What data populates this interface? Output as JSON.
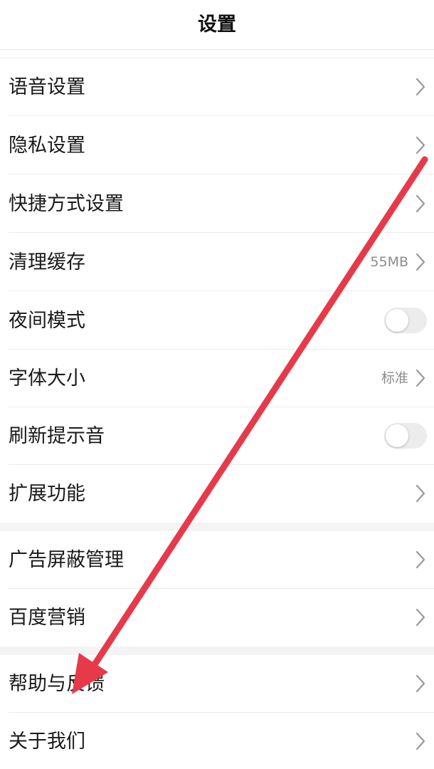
{
  "header": {
    "title": "设置"
  },
  "section1": {
    "voice": {
      "label": "语音设置"
    },
    "privacy": {
      "label": "隐私设置"
    },
    "shortcut": {
      "label": "快捷方式设置"
    },
    "cache": {
      "label": "清理缓存",
      "value": "55MB"
    },
    "night": {
      "label": "夜间模式",
      "on": false
    },
    "font": {
      "label": "字体大小",
      "value": "标准"
    },
    "refresh_sound": {
      "label": "刷新提示音",
      "on": false
    },
    "extensions": {
      "label": "扩展功能"
    }
  },
  "section2": {
    "adblock": {
      "label": "广告屏蔽管理"
    },
    "marketing": {
      "label": "百度营销"
    }
  },
  "section3": {
    "help": {
      "label": "帮助与反馈"
    },
    "about": {
      "label": "关于我们"
    }
  },
  "colors": {
    "annotation_arrow": "#e63a4b",
    "toggle_off": "#ececec",
    "secondary_text": "#8c8c8c",
    "chevron": "#9a9a9a"
  },
  "icons": {
    "chevron": "chevron-right-icon",
    "annotation": "red-arrow-annotation"
  }
}
